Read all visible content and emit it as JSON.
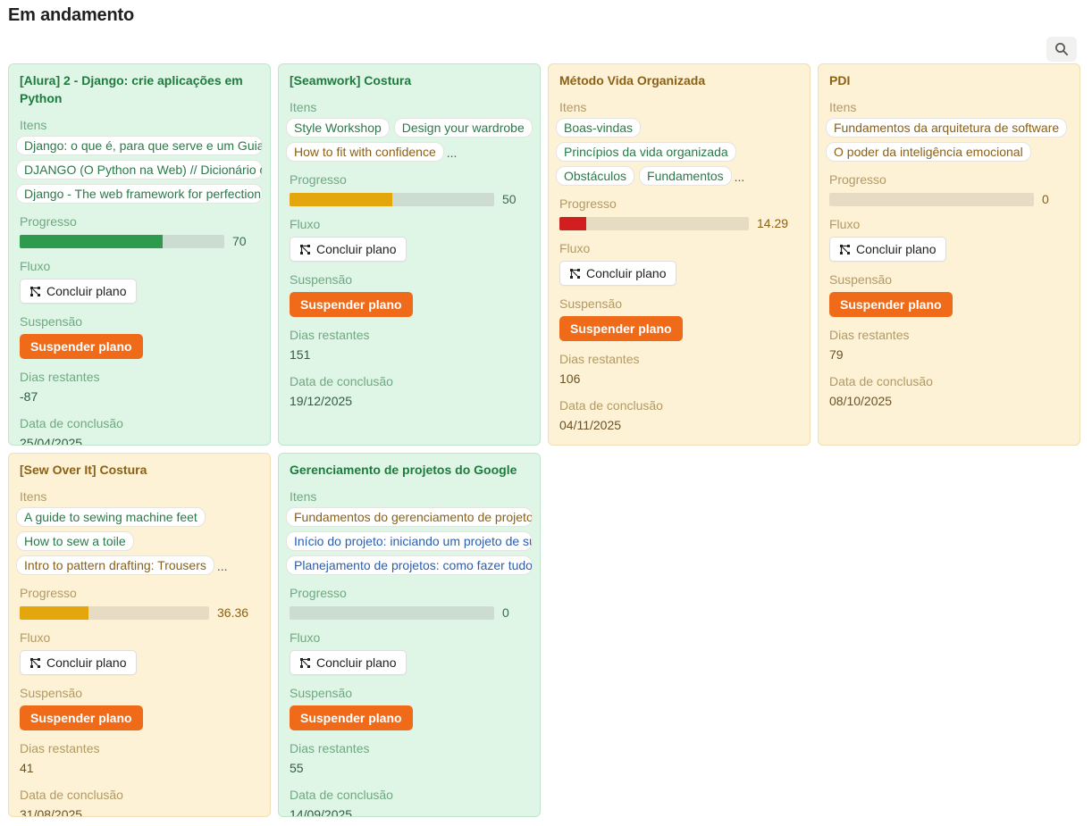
{
  "page": {
    "title": "Em andamento"
  },
  "labels": {
    "items": "Itens",
    "progress": "Progresso",
    "flow": "Fluxo",
    "suspension": "Suspensão",
    "days_remaining": "Dias restantes",
    "completion_date": "Data de conclusão",
    "conclude_button": "Concluir plano",
    "suspend_button": "Suspender plano",
    "more": "..."
  },
  "colors": {
    "green_bg": "#dff5e5",
    "yellow_bg": "#fdf1d6",
    "orange_button": "#ef6b1a",
    "progress_green": "#2e9a4e",
    "progress_yellow": "#e3a70d",
    "progress_red": "#d11f1f"
  },
  "cards": [
    {
      "title": "[Alura] 2 - Django: crie aplicações em Python",
      "theme": "green",
      "items": [
        {
          "label": "Django: o que é, para que serve e um Guia",
          "color": "green"
        },
        {
          "label": "DJANGO (O Python na Web) // Dicionário do Programador",
          "color": "green"
        },
        {
          "label": "Django - The web framework for perfectionists",
          "color": "green"
        }
      ],
      "progress": 70,
      "progress_color": "#2e9a4e",
      "days_remaining": "-87",
      "completion_date": "25/04/2025"
    },
    {
      "title": "[Seamwork] Costura",
      "theme": "green",
      "items": [
        {
          "label": "Style Workshop",
          "color": "green"
        },
        {
          "label": "Design your wardrobe",
          "color": "green"
        },
        {
          "label": "How to fit with confidence",
          "color": "yellow"
        }
      ],
      "has_more": true,
      "progress": 50,
      "progress_color": "#e3a70d",
      "days_remaining": "151",
      "completion_date": "19/12/2025"
    },
    {
      "title": "Método Vida Organizada",
      "theme": "yellow",
      "items": [
        {
          "label": "Boas-vindas",
          "color": "green"
        },
        {
          "label": "Princípios da vida organizada",
          "color": "green"
        },
        {
          "label": "Obstáculos",
          "color": "green"
        },
        {
          "label": "Fundamentos",
          "color": "green"
        }
      ],
      "has_more": true,
      "progress": 14.29,
      "progress_color": "#d11f1f",
      "days_remaining": "106",
      "completion_date": "04/11/2025"
    },
    {
      "title": "PDI",
      "theme": "yellow",
      "items": [
        {
          "label": "Fundamentos da arquitetura de software",
          "color": "yellow"
        },
        {
          "label": "O poder da inteligência emocional",
          "color": "yellow"
        }
      ],
      "progress": 0,
      "progress_color": "#e3a70d",
      "days_remaining": "79",
      "completion_date": "08/10/2025"
    },
    {
      "title": "[Sew Over It] Costura",
      "theme": "yellow",
      "items": [
        {
          "label": "A guide to sewing machine feet",
          "color": "green"
        },
        {
          "label": "How to sew a toile",
          "color": "green"
        },
        {
          "label": "Intro to pattern drafting: Trousers",
          "color": "yellow"
        }
      ],
      "has_more": true,
      "progress": 36.36,
      "progress_color": "#e3a70d",
      "days_remaining": "41",
      "completion_date": "31/08/2025"
    },
    {
      "title": "Gerenciamento de projetos do Google",
      "theme": "green",
      "items": [
        {
          "label": "Fundamentos do gerenciamento de projetos",
          "color": "yellow"
        },
        {
          "label": "Início do projeto: iniciando um projeto de sucesso",
          "color": "blue"
        },
        {
          "label": "Planejamento de projetos: como fazer tudo funcionar",
          "color": "blue"
        }
      ],
      "progress": 0,
      "progress_color": "#2e9a4e",
      "days_remaining": "55",
      "completion_date": "14/09/2025"
    }
  ]
}
